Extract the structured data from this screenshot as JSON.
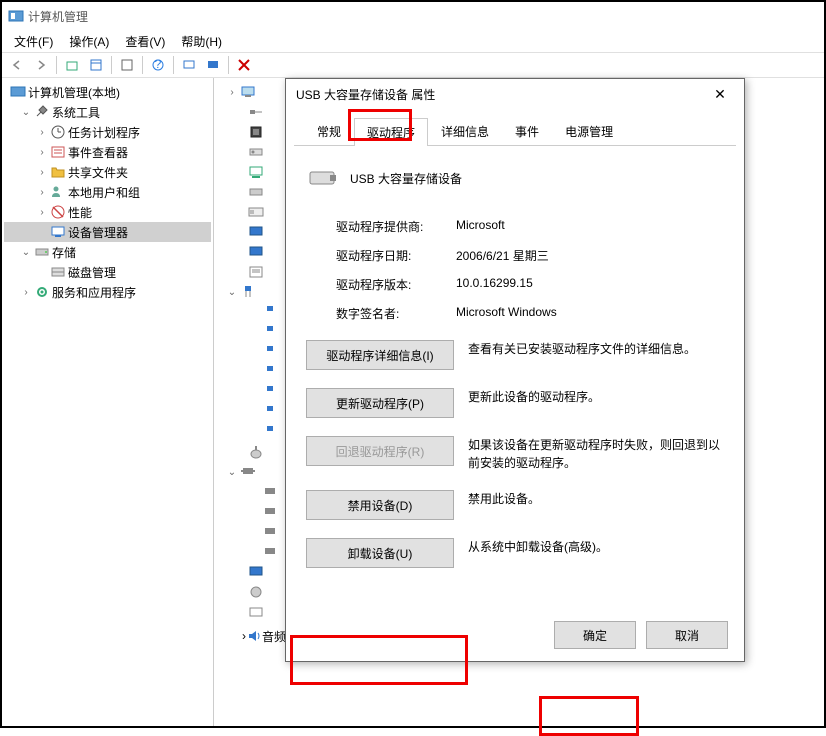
{
  "window": {
    "title": "计算机管理"
  },
  "menubar": {
    "file": "文件(F)",
    "action": "操作(A)",
    "view": "查看(V)",
    "help": "帮助(H)"
  },
  "tree": {
    "root": "计算机管理(本地)",
    "system_tools": "系统工具",
    "task_scheduler": "任务计划程序",
    "event_viewer": "事件查看器",
    "shared_folders": "共享文件夹",
    "local_users": "本地用户和组",
    "performance": "性能",
    "device_manager": "设备管理器",
    "storage": "存储",
    "disk_mgmt": "磁盘管理",
    "services_apps": "服务和应用程序"
  },
  "detail": {
    "audio_io": "音频输入和输出"
  },
  "dialog": {
    "title": "USB 大容量存储设备 属性",
    "tabs": {
      "general": "常规",
      "driver": "驱动程序",
      "details": "详细信息",
      "events": "事件",
      "power": "电源管理"
    },
    "device_name": "USB 大容量存储设备",
    "provider_label": "驱动程序提供商:",
    "provider": "Microsoft",
    "date_label": "驱动程序日期:",
    "date": "2006/6/21 星期三",
    "version_label": "驱动程序版本:",
    "version": "10.0.16299.15",
    "signer_label": "数字签名者:",
    "signer": "Microsoft Windows",
    "btn_details": "驱动程序详细信息(I)",
    "desc_details": "查看有关已安装驱动程序文件的详细信息。",
    "btn_update": "更新驱动程序(P)",
    "desc_update": "更新此设备的驱动程序。",
    "btn_rollback": "回退驱动程序(R)",
    "desc_rollback": "如果该设备在更新驱动程序时失败，则回退到以前安装的驱动程序。",
    "btn_disable": "禁用设备(D)",
    "desc_disable": "禁用此设备。",
    "btn_uninstall": "卸载设备(U)",
    "desc_uninstall": "从系统中卸载设备(高级)。",
    "ok": "确定",
    "cancel": "取消"
  }
}
